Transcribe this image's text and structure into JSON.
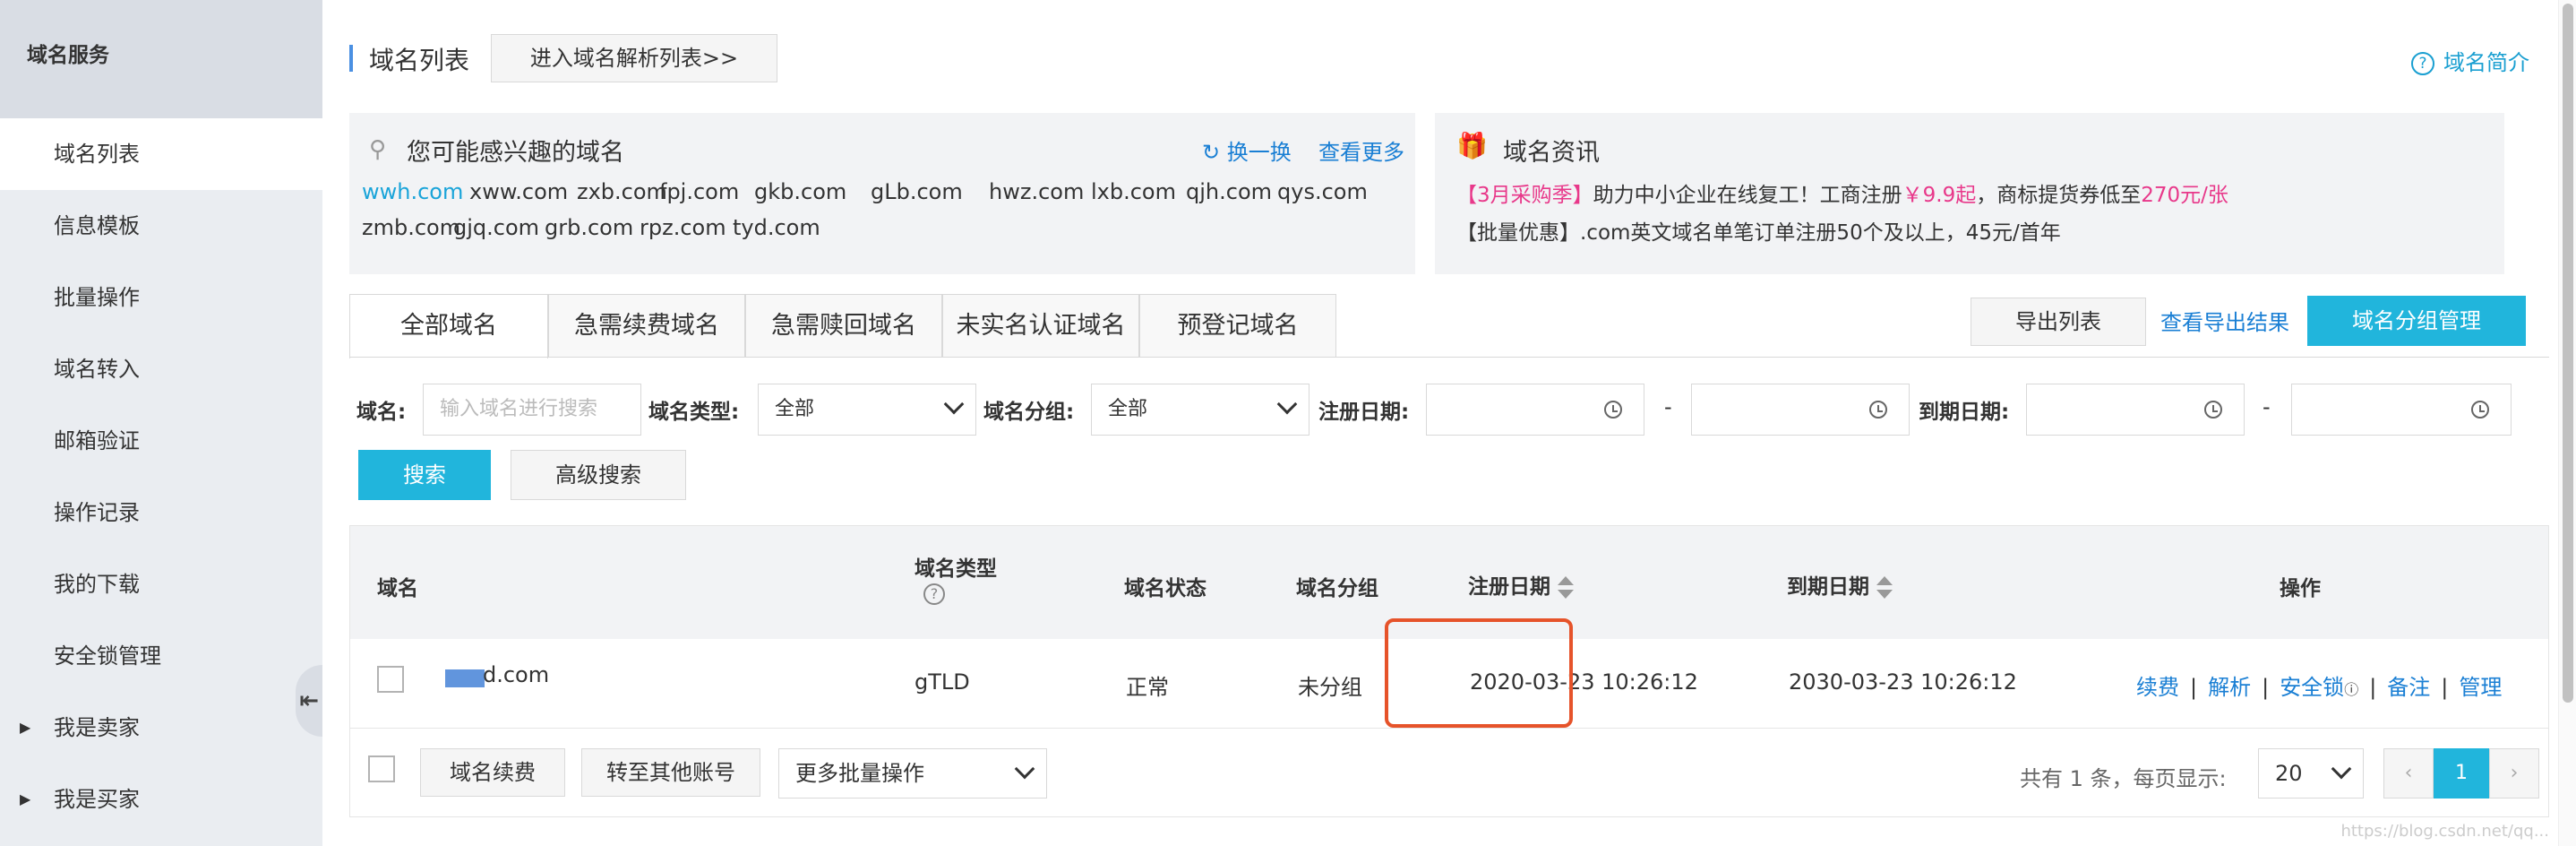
{
  "sidebar": {
    "brand": "域名服务",
    "items": [
      {
        "label": "域名列表",
        "active": true
      },
      {
        "label": "信息模板"
      },
      {
        "label": "批量操作"
      },
      {
        "label": "域名转入"
      },
      {
        "label": "邮箱验证"
      },
      {
        "label": "操作记录"
      },
      {
        "label": "我的下载"
      },
      {
        "label": "安全锁管理"
      },
      {
        "label": "我是卖家"
      },
      {
        "label": "我是买家"
      }
    ],
    "collapse_icon": "collapse-icon"
  },
  "header": {
    "title": "域名列表",
    "dns_button": "进入域名解析列表>>",
    "intro_link": "域名简介"
  },
  "interest": {
    "title": "您可能感兴趣的域名",
    "refresh": "换一换",
    "more": "查看更多",
    "domains_row1": [
      "wwh.com",
      "xww.com",
      "zxb.com",
      "fpj.com",
      "gkb.com",
      "gLb.com",
      "hwz.com",
      "lxb.com",
      "qjh.com",
      "qys.com"
    ],
    "domains_row2": [
      "zmb.com",
      "gjq.com",
      "grb.com",
      "rpz.com",
      "tyd.com"
    ]
  },
  "news": {
    "title": "域名资讯",
    "line1_tag": "【3月采购季】",
    "line1_text_a": "助力中小企业在线复工！工商注册",
    "line1_price": "￥9.9起",
    "line1_text_b": "，商标提货券低至",
    "line1_price2": "270元/张",
    "line2": "【批量优惠】.com英文域名单笔订单注册50个及以上，45元/首年"
  },
  "tabs": [
    "全部域名",
    "急需续费域名",
    "急需赎回域名",
    "未实名认证域名",
    "预登记域名"
  ],
  "toolbar": {
    "export": "导出列表",
    "export_results": "查看导出结果",
    "group_manage": "域名分组管理"
  },
  "filters": {
    "domain_label": "域名:",
    "domain_placeholder": "输入域名进行搜索",
    "type_label": "域名类型:",
    "type_value": "全部",
    "group_label": "域名分组:",
    "group_value": "全部",
    "reg_label": "注册日期:",
    "exp_label": "到期日期:",
    "dash": "-",
    "search": "搜索",
    "advanced": "高级搜索"
  },
  "table": {
    "headers": {
      "domain": "域名",
      "type": "域名类型",
      "status": "域名状态",
      "group": "域名分组",
      "reg_date": "注册日期",
      "exp_date": "到期日期",
      "actions": "操作"
    },
    "rows": [
      {
        "domain": "d.com",
        "type": "gTLD",
        "status": "正常",
        "group": "未分组",
        "reg_date": "2020-03-23 10:26:12",
        "exp_date": "2030-03-23 10:26:12",
        "actions": [
          "续费",
          "解析",
          "安全锁",
          "备注",
          "管理"
        ],
        "separator": "|"
      }
    ],
    "footer": {
      "renew": "域名续费",
      "transfer": "转至其他账号",
      "more_batch": "更多批量操作",
      "total_text": "共有 1 条，每页显示:",
      "page_size": "20",
      "prev": "‹",
      "current_page": "1",
      "next": "›"
    }
  },
  "watermark": "https://blog.csdn.net/qq..."
}
